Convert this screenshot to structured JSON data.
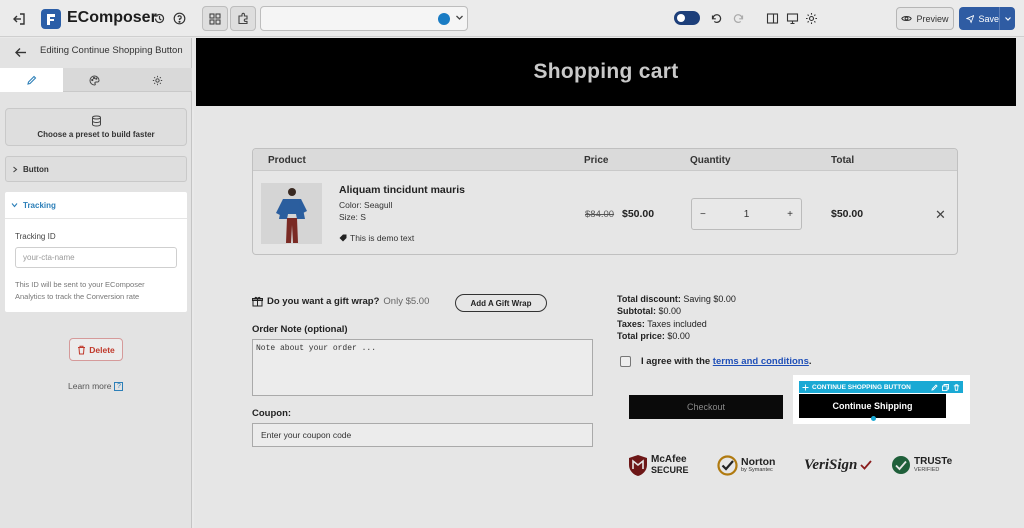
{
  "app": {
    "brand": "EComposer",
    "colors": {
      "accent": "#2f5ca3",
      "selection": "#1aa9d4",
      "danger": "#c0392b"
    }
  },
  "topbar": {
    "icons": [
      "exit-icon",
      "history-icon",
      "help-icon",
      "grid-icon",
      "puzzle-icon",
      "globe-icon",
      "undo-icon",
      "redo-icon",
      "sidebar-icon",
      "desktop-icon",
      "gear-icon"
    ],
    "preview_label": "Preview",
    "save_label": "Save"
  },
  "left_panel": {
    "title": "Editing Continue Shopping Button",
    "tabs": [
      "content-tab",
      "style-tab",
      "settings-tab"
    ],
    "preset_label": "Choose a preset to build faster",
    "sections": {
      "button": "Button",
      "tracking": "Tracking"
    },
    "tracking": {
      "field_label": "Tracking ID",
      "placeholder": "your-cta-name",
      "help_line1": "This ID will be sent to your EComposer",
      "help_line2": "Analytics to track the Conversion rate"
    },
    "delete_label": "Delete",
    "learn_more": "Learn more"
  },
  "canvas": {
    "banner_title": "Shopping cart",
    "table_headers": [
      "Product",
      "Price",
      "Quantity",
      "Total"
    ],
    "item": {
      "name": "Aliquam tincidunt mauris",
      "color": "Color: Seagull",
      "size": "Size: S",
      "note": "This is demo text",
      "price_old": "$84.00",
      "price_new": "$50.00",
      "quantity": "1",
      "total": "$50.00"
    },
    "gift": {
      "question": "Do you want a gift wrap?",
      "price": "Only $5.00",
      "button": "Add A Gift Wrap"
    },
    "order_note": {
      "label": "Order Note (optional)",
      "placeholder": "Note about your order ..."
    },
    "coupon": {
      "label": "Coupon:",
      "placeholder": "Enter your coupon code"
    },
    "summary": {
      "discount_label": "Total discount:",
      "discount_value": "Saving $0.00",
      "subtotal_label": "Subtotal:",
      "subtotal_value": "$0.00",
      "taxes_label": "Taxes:",
      "taxes_value": "Taxes included",
      "total_label": "Total price:",
      "total_value": "$0.00"
    },
    "agree": {
      "text": "I agree with the",
      "link": "terms and conditions",
      "end": "."
    },
    "checkout_label": "Checkout",
    "selected_element_label": "CONTINUE SHOPPING BUTTON",
    "continue_label": "Continue Shipping",
    "trust_badges": {
      "mcafee_1": "McAfee",
      "mcafee_2": "SECURE",
      "norton_1": "Norton",
      "norton_2": "by Symantec",
      "verisign": "VeriSign",
      "truste_1": "TRUSTe",
      "truste_2": "VERIFIED"
    }
  }
}
